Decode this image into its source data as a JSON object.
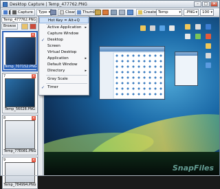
{
  "window": {
    "title": "Desktop Capture | Temp_477762.PNG",
    "buttons": [
      "–",
      "□",
      "✕"
    ]
  },
  "toolbar": {
    "capture_label": "Capture",
    "type_label": "Type",
    "clear_label": "Clear",
    "thumbs_label": "Thumbs",
    "create_label": "Create",
    "folder_value": "Temp",
    "format_value": ".PNG",
    "zoom_value": "100"
  },
  "panel": {
    "path_value": "Temp_477762.PNG",
    "browse_label": "Browse",
    "thumbnails": [
      {
        "number": "",
        "caption": "Temp_707152.PNG",
        "active": true
      },
      {
        "number": "7",
        "caption": "Temp_56028.PNG",
        "active": false
      },
      {
        "number": "8",
        "caption": "Temp_77E081.PNG",
        "active": false
      },
      {
        "number": "9",
        "caption": "Temp_784994.PNG",
        "active": false
      }
    ]
  },
  "menu": {
    "items": [
      {
        "label": "Hot Key = Alt+Q",
        "checked": false,
        "submenu": false,
        "highlight": true
      },
      {
        "label": "Active Application",
        "checked": false,
        "submenu": true,
        "highlight": false
      },
      {
        "label": "Capture Window",
        "checked": false,
        "submenu": false,
        "highlight": false
      },
      {
        "label": "Desktop",
        "checked": true,
        "submenu": false,
        "highlight": false
      },
      {
        "label": "Screen",
        "checked": false,
        "submenu": false,
        "highlight": false
      },
      {
        "label": "Virtual Desktop",
        "checked": false,
        "submenu": false,
        "highlight": false
      },
      {
        "label": "Application",
        "checked": false,
        "submenu": true,
        "highlight": false
      },
      {
        "label": "Default Window",
        "checked": false,
        "submenu": false,
        "highlight": false
      },
      {
        "label": "Directory",
        "checked": false,
        "submenu": true,
        "highlight": false
      },
      {
        "label": "Gray Scale",
        "checked": false,
        "submenu": false,
        "highlight": false
      },
      {
        "label": "Timer",
        "checked": true,
        "submenu": false,
        "highlight": false
      }
    ]
  },
  "watermark": "SnapFiles"
}
